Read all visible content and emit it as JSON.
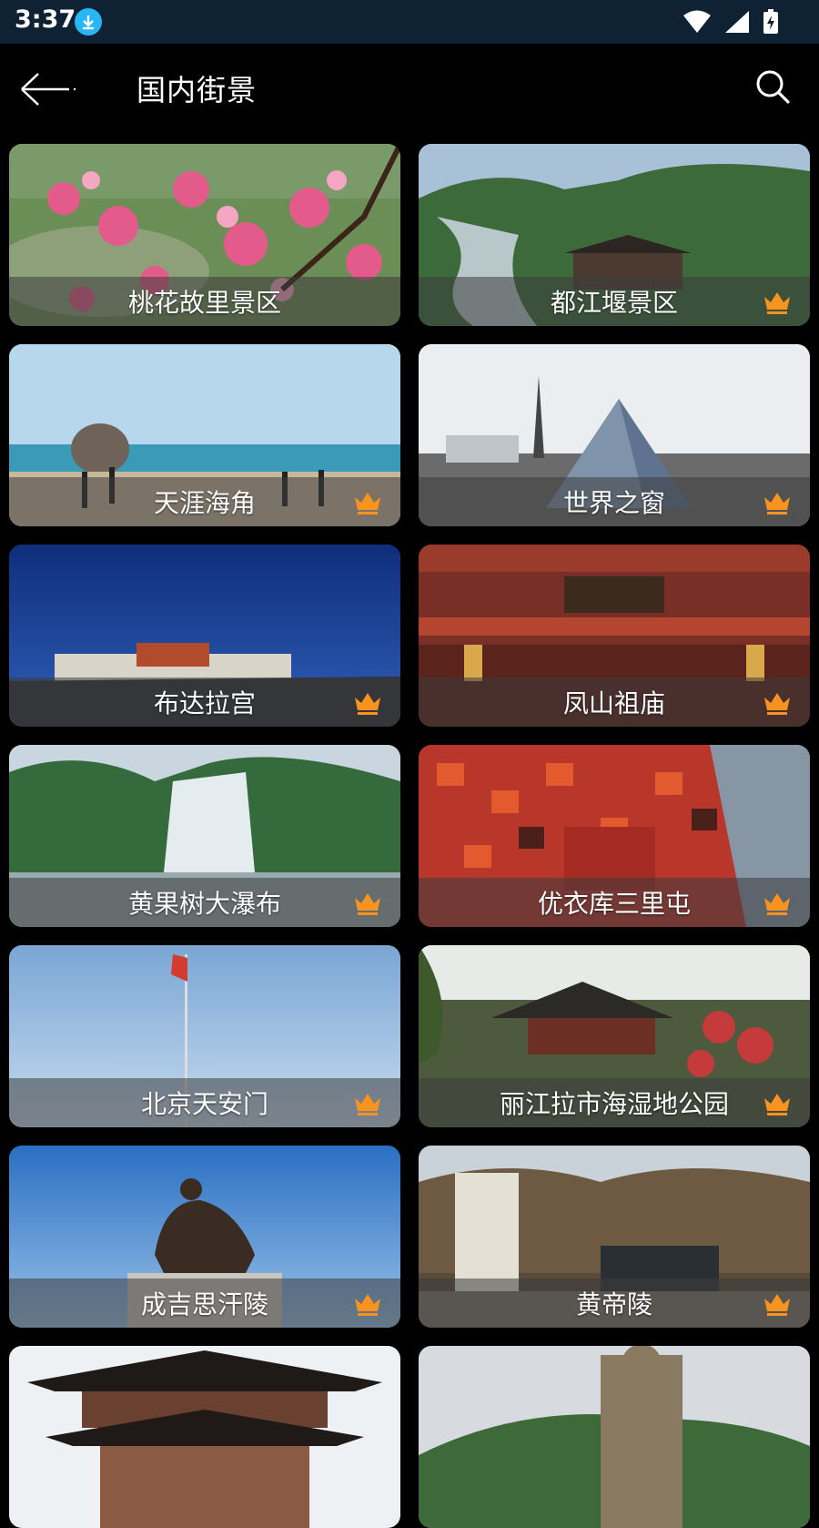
{
  "status_bar": {
    "time": "3:37",
    "icons": [
      "download-icon",
      "wifi-icon",
      "signal-icon",
      "battery-charging-icon"
    ]
  },
  "app_bar": {
    "title": "国内街景",
    "back_icon": "arrow-left-icon",
    "search_icon": "search-icon"
  },
  "colors": {
    "status_bar_bg": "#0e2233",
    "accent_crown": "#f7931e",
    "download_badge": "#29b6f6"
  },
  "cards": [
    {
      "name": "桃花故里景区",
      "premium": false
    },
    {
      "name": "都江堰景区",
      "premium": true
    },
    {
      "name": "天涯海角",
      "premium": true
    },
    {
      "name": "世界之窗",
      "premium": true
    },
    {
      "name": "布达拉宫",
      "premium": true
    },
    {
      "name": "凤山祖庙",
      "premium": true
    },
    {
      "name": "黄果树大瀑布",
      "premium": true
    },
    {
      "name": "优衣库三里屯",
      "premium": true
    },
    {
      "name": "北京天安门",
      "premium": true
    },
    {
      "name": "丽江拉市海湿地公园",
      "premium": true
    },
    {
      "name": "成吉思汗陵",
      "premium": true
    },
    {
      "name": "黄帝陵",
      "premium": true
    },
    {
      "name": "",
      "premium": false
    },
    {
      "name": "",
      "premium": false
    }
  ]
}
